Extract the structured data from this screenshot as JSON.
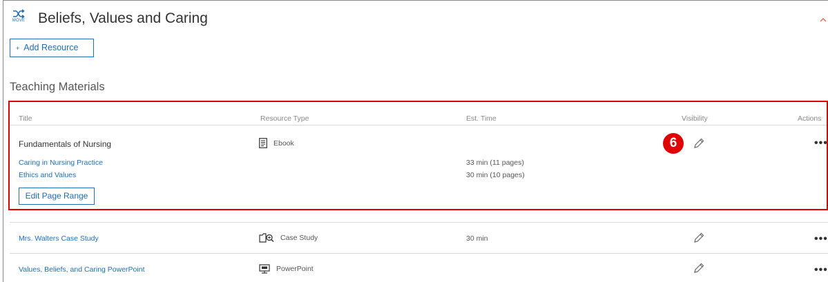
{
  "module": {
    "move_label": "MOVE",
    "title": "Beliefs, Values and Caring",
    "add_resource_label": "Add Resource",
    "add_resource_prefix": "+"
  },
  "section_title": "Teaching Materials",
  "table": {
    "headers": [
      "Title",
      "Resource Type",
      "Est. Time",
      "Visibility",
      "Actions"
    ],
    "ebook": {
      "title": "Fundamentals of Nursing",
      "type": "Ebook",
      "type_icon": "ebook-icon",
      "chapters": [
        {
          "title": "Caring in Nursing Practice",
          "time": "33 min (11 pages)"
        },
        {
          "title": "Ethics and Values",
          "time": "30 min (10 pages)"
        }
      ],
      "edit_range_label": "Edit Page Range"
    },
    "rows": [
      {
        "title": "Mrs. Walters Case Study",
        "type": "Case Study",
        "type_icon": "case-study-icon",
        "time": "30 min"
      },
      {
        "title": "Values, Beliefs, and Caring PowerPoint",
        "type": "PowerPoint",
        "type_icon": "powerpoint-icon",
        "time": ""
      }
    ],
    "actions_glyph": "•••"
  },
  "annotation": {
    "callout_number": "6",
    "callout_color": "#e00000"
  },
  "colors": {
    "accent": "#1f6db3",
    "highlight": "#e00000"
  }
}
